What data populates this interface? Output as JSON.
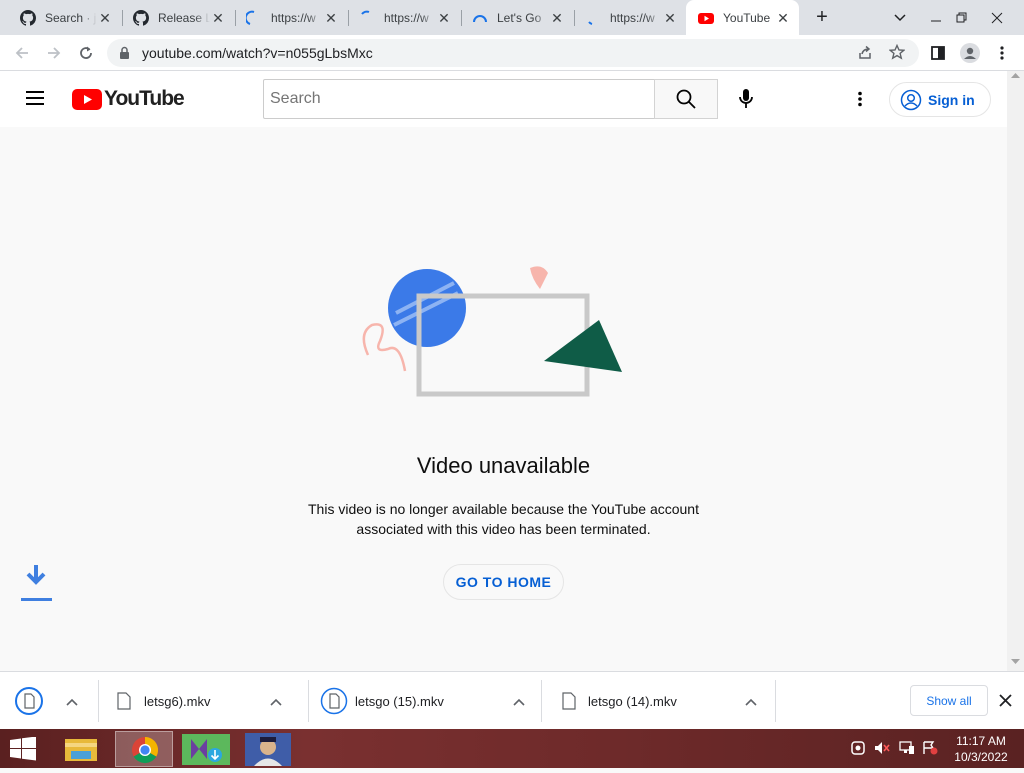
{
  "browser": {
    "tabs": [
      {
        "title": "Search · j",
        "icon": "github-icon"
      },
      {
        "title": "Release L",
        "icon": "github-icon"
      },
      {
        "title": "https://w",
        "icon": "loading-spinner-icon"
      },
      {
        "title": "https://w",
        "icon": "loading-spinner-icon"
      },
      {
        "title": "Let's Go",
        "icon": "loading-spinner-icon"
      },
      {
        "title": "https://w",
        "icon": "loading-spinner-icon"
      },
      {
        "title": "YouTube",
        "icon": "youtube-icon",
        "active": true
      }
    ],
    "new_tab_label": "+",
    "url": "youtube.com/watch?v=n055gLbsMxc"
  },
  "youtube": {
    "logo_text": "YouTube",
    "search_placeholder": "Search",
    "sign_in_label": "Sign in",
    "brand_color": "#ff0000",
    "link_color": "#065fd4"
  },
  "message": {
    "title": "Video unavailable",
    "line1": "This video is no longer available because the YouTube account",
    "line2": "associated with this video has been terminated.",
    "button": "GO TO HOME"
  },
  "downloads": {
    "items": [
      {
        "name": "letsg6).mkv"
      },
      {
        "name": "letsgo (15).mkv"
      },
      {
        "name": "letsgo (14).mkv"
      }
    ],
    "show_all": "Show all"
  },
  "taskbar": {
    "time": "11:17 AM",
    "date": "10/3/2022"
  }
}
